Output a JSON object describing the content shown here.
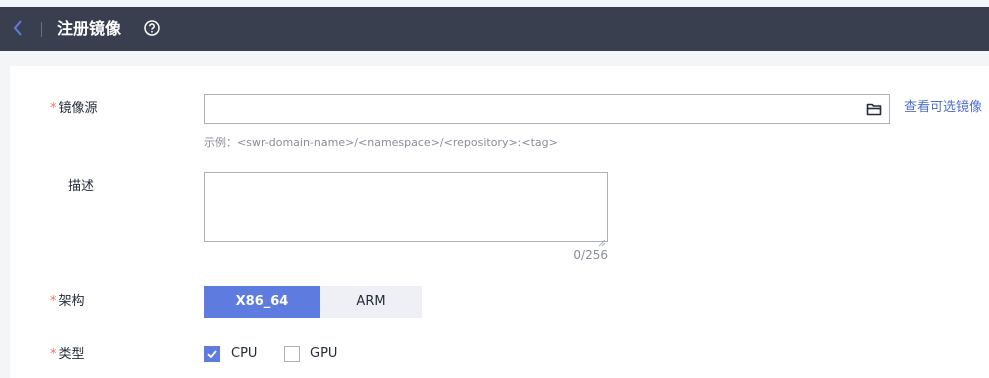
{
  "header": {
    "back_icon": "chevron-left-icon",
    "title": "注册镜像",
    "help_icon": "question-circle-icon"
  },
  "form": {
    "required_mark": "*",
    "image_source": {
      "label": "镜像源",
      "value": "",
      "folder_icon": "folder-icon",
      "link_label": "查看可选镜像",
      "hint": "示例：<swr-domain-name>/<namespace>/<repository>:<tag>"
    },
    "description": {
      "label": "描述",
      "value": "",
      "counter": "0/256"
    },
    "architecture": {
      "label": "架构",
      "options": [
        "X86_64",
        "ARM"
      ],
      "selected": "X86_64"
    },
    "type": {
      "label": "类型",
      "options": [
        {
          "label": "CPU",
          "checked": true
        },
        {
          "label": "GPU",
          "checked": false
        }
      ]
    }
  },
  "colors": {
    "header_bg": "#3a3f4f",
    "accent": "#5e7ce0",
    "link": "#526ecc",
    "required": "#f66f6a"
  }
}
